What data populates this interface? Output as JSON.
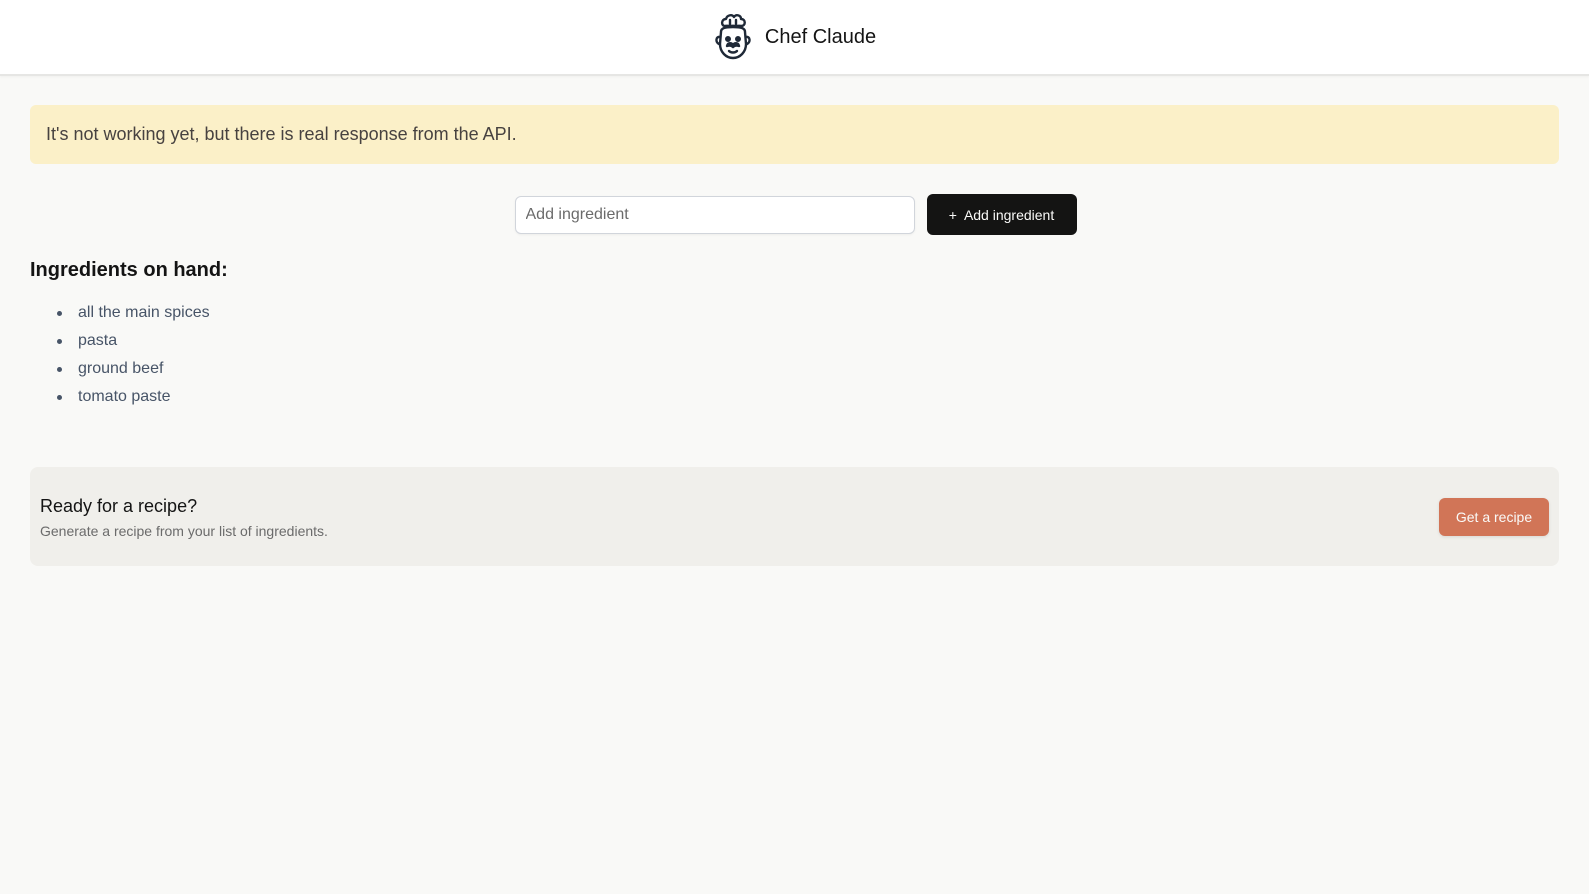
{
  "header": {
    "logo_icon": "chef-icon",
    "title": "Chef Claude"
  },
  "notice": {
    "text": "It's not working yet, but there is real response from the API."
  },
  "form": {
    "input_value": "",
    "input_placeholder": "Add ingredient",
    "add_button_icon": "+",
    "add_button_label": "Add ingredient"
  },
  "ingredients": {
    "heading": "Ingredients on hand:",
    "items": [
      "all the main spices",
      "pasta",
      "ground beef",
      "tomato paste"
    ]
  },
  "recipe_card": {
    "heading": "Ready for a recipe?",
    "subtext": "Generate a recipe from your list of ingredients.",
    "button_label": "Get a recipe"
  },
  "colors": {
    "notice_bg": "#fbf0c8",
    "add_button_bg": "#141413",
    "recipe_button_bg": "#d17557",
    "recipe_card_bg": "#f0efeb"
  }
}
